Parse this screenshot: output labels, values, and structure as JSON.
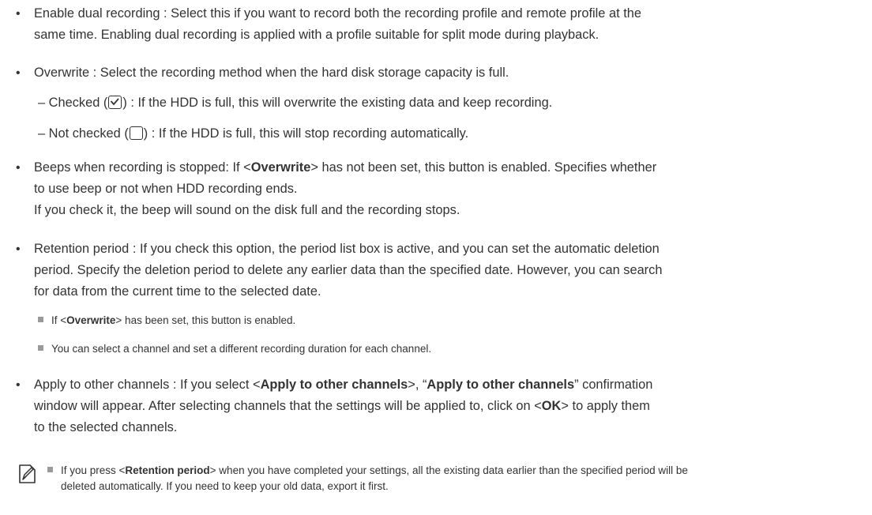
{
  "bullets": {
    "dual": {
      "line1": "Enable dual recording : Select this if you want to record both the recording profile and remote profile at the",
      "line2": "same time. Enabling dual recording is applied with a profile suitable for split mode during playback."
    },
    "overwrite": {
      "text": "Overwrite : Select the recording method when the hard disk storage capacity is full.",
      "checked_prefix": "– Checked (",
      "checked_suffix": ") : If the HDD is full, this will overwrite the existing data and keep recording.",
      "unchecked_prefix": "– Not checked (",
      "unchecked_suffix": ") : If the HDD is full, this will stop recording automatically."
    },
    "beeps": {
      "line1_pre": "Beeps when recording is stopped: If <",
      "line1_bold": "Overwrite",
      "line1_post": "> has not been set, this button is enabled. Specifies whether",
      "line2": "to use beep or not when HDD recording ends.",
      "line3": "If you check it, the beep will sound on the disk full and the recording stops."
    },
    "retention": {
      "line1": "Retention period : If you check this option, the period list box is active, and you can set the automatic deletion",
      "line2": "period. Specify the deletion period to delete any earlier data than the specified date. However, you can search",
      "line3": "for data from the current time to the selected date.",
      "note1_pre": "If <",
      "note1_bold": "Overwrite",
      "note1_post": "> has been set, this button is enabled.",
      "note2": "You can select a channel and set a different recording duration for each channel."
    },
    "apply": {
      "l1_a": "Apply to other channels : If you select <",
      "l1_b": "Apply to other channels",
      "l1_c": ">, “",
      "l1_d": "Apply to other channels",
      "l1_e": "” confirmation",
      "l2_a": "window will appear. After selecting channels that the settings will be applied to, click on <",
      "l2_b": "OK",
      "l2_c": "> to apply them",
      "line3": "to the selected channels."
    }
  },
  "memo": {
    "icon": "memo-pencil-icon",
    "line1_pre": "If you press <",
    "line1_bold": "Retention period",
    "line1_post": "> when you have completed your settings, all the existing data earlier than the specified period will be",
    "line2": "deleted automatically. If you need to keep your old data, export it first."
  }
}
